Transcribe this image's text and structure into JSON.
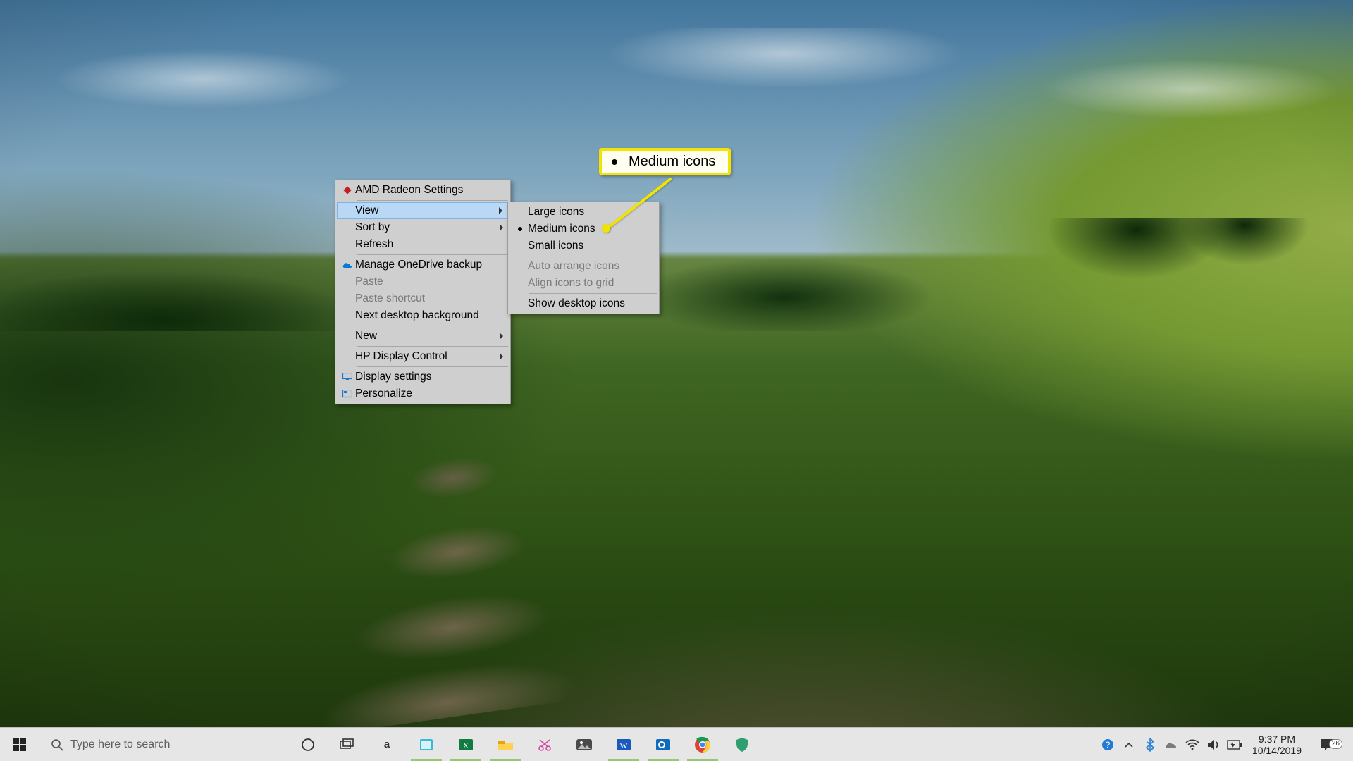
{
  "callout": {
    "label": "Medium icons"
  },
  "context_menu_main": {
    "items": {
      "amd": {
        "label": "AMD Radeon Settings"
      },
      "view": {
        "label": "View"
      },
      "sortby": {
        "label": "Sort by"
      },
      "refresh": {
        "label": "Refresh"
      },
      "onedrive": {
        "label": "Manage OneDrive backup"
      },
      "paste": {
        "label": "Paste"
      },
      "pastesc": {
        "label": "Paste shortcut"
      },
      "nextbg": {
        "label": "Next desktop background"
      },
      "new": {
        "label": "New"
      },
      "hpdisplay": {
        "label": "HP Display Control"
      },
      "dispset": {
        "label": "Display settings"
      },
      "personalize": {
        "label": "Personalize"
      }
    }
  },
  "context_menu_view": {
    "items": {
      "large": {
        "label": "Large icons"
      },
      "medium": {
        "label": "Medium icons"
      },
      "small": {
        "label": "Small icons"
      },
      "autoarr": {
        "label": "Auto arrange icons"
      },
      "align": {
        "label": "Align icons to grid"
      },
      "showdesk": {
        "label": "Show desktop icons"
      }
    }
  },
  "taskbar": {
    "search_placeholder": "Type here to search",
    "clock_time": "9:37 PM",
    "clock_date": "10/14/2019",
    "action_center_badge": "26"
  }
}
